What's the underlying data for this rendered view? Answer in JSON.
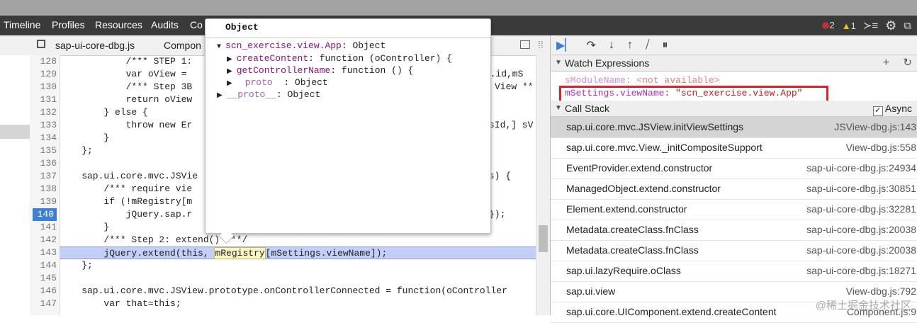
{
  "main_tabs": [
    "Timeline",
    "Profiles",
    "Resources",
    "Audits",
    "Co"
  ],
  "status": {
    "errors": "2",
    "warnings": "1"
  },
  "file_tabs": {
    "file1": "sap-ui-core-dbg.js",
    "file2": "Compon"
  },
  "code_lines": [
    {
      "n": "128",
      "t": "            /*** STEP 1: "
    },
    {
      "n": "129",
      "t": "            var oView = "
    },
    {
      "n": "130",
      "t": "            /*** Step 3B"
    },
    {
      "n": "131",
      "t": "            return oView"
    },
    {
      "n": "132",
      "t": "        } else {"
    },
    {
      "n": "133",
      "t": "            throw new Er"
    },
    {
      "n": "134",
      "t": "        }"
    },
    {
      "n": "135",
      "t": "    };"
    },
    {
      "n": "136",
      "t": ""
    },
    {
      "n": "137",
      "t": "    sap.ui.core.mvc.JSVie"
    },
    {
      "n": "138",
      "t": "        /*** require vie"
    },
    {
      "n": "139",
      "t": "        if (!mRegistry[m"
    },
    {
      "n": "140",
      "t": "            jQuery.sap.r"
    },
    {
      "n": "141",
      "t": "        }"
    },
    {
      "n": "142",
      "t": "        /*** Step 2: extend() ***/"
    },
    {
      "n": "143",
      "t": "        jQuery.extend(this, "
    },
    {
      "n": "144",
      "t": "    };"
    },
    {
      "n": "145",
      "t": ""
    },
    {
      "n": "146",
      "t": "    sap.ui.core.mvc.JSView.prototype.onControllerConnected = function(oController"
    },
    {
      "n": "147",
      "t": "        var that=this;"
    }
  ],
  "code_right_fragments": {
    "l129": "gs.id,mS",
    "l130": "View **",
    "l133": "sId,] sV",
    "l137": "gs) {",
    "l140": "});"
  },
  "highlight_line": {
    "registry": "mRegistry",
    "rest": "[mSettings.viewName]);"
  },
  "popup": {
    "title": "Object",
    "root_name": "scn_exercise.view.App",
    "root_type": ": Object",
    "rows": [
      {
        "key": "createContent",
        "val": ": function (oController) {"
      },
      {
        "key": "getControllerName",
        "val": ": function () {"
      },
      {
        "key": "proto",
        "val": "  : Object"
      }
    ],
    "proto_key": "__proto__",
    "proto_val": ": Object"
  },
  "watch": {
    "title": "Watch Expressions",
    "items": [
      {
        "name": "sModuleName",
        "val": ": <not available>"
      },
      {
        "name": "mSettings.viewName",
        "val": ": \"scn_exercise.view.App\""
      }
    ]
  },
  "callstack": {
    "title": "Call Stack",
    "async": "Async",
    "frames": [
      {
        "fn": "sap.ui.core.mvc.JSView.initViewSettings",
        "loc": "JSView-dbg.js:143"
      },
      {
        "fn": "sap.ui.core.mvc.View._initCompositeSupport",
        "loc": "View-dbg.js:558"
      },
      {
        "fn": "EventProvider.extend.constructor",
        "loc": "sap-ui-core-dbg.js:24934"
      },
      {
        "fn": "ManagedObject.extend.constructor",
        "loc": "sap-ui-core-dbg.js:30851"
      },
      {
        "fn": "Element.extend.constructor",
        "loc": "sap-ui-core-dbg.js:32281"
      },
      {
        "fn": "Metadata.createClass.fnClass",
        "loc": "sap-ui-core-dbg.js:20038"
      },
      {
        "fn": "Metadata.createClass.fnClass",
        "loc": "sap-ui-core-dbg.js:20038"
      },
      {
        "fn": "sap.ui.lazyRequire.oClass",
        "loc": "sap-ui-core-dbg.js:18271"
      },
      {
        "fn": "sap.ui.view",
        "loc": "View-dbg.js:792"
      },
      {
        "fn": "sap.ui.core.UIComponent.extend.createContent",
        "loc": "Component.js:9"
      }
    ]
  },
  "watermark": "@稀土掘金技术社区"
}
